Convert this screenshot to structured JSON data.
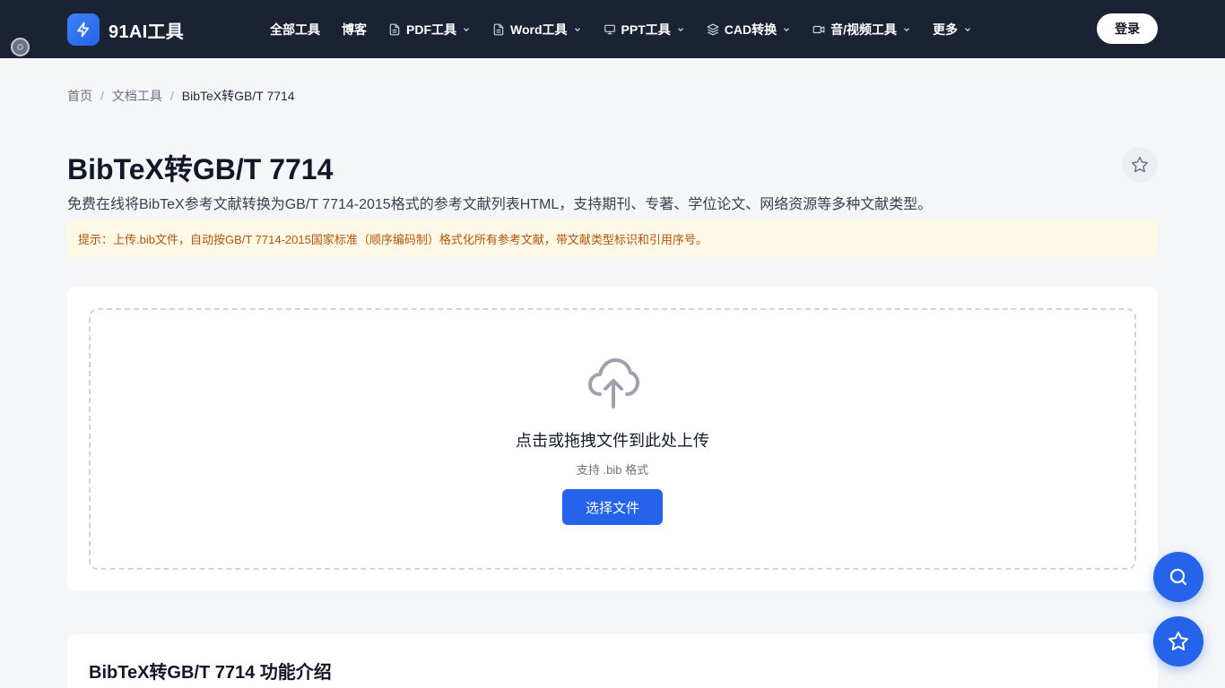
{
  "header": {
    "logo_text": "91AI工具",
    "nav": [
      {
        "label": "全部工具",
        "icon": null
      },
      {
        "label": "博客",
        "icon": null
      },
      {
        "label": "PDF工具",
        "icon": "document-icon"
      },
      {
        "label": "Word工具",
        "icon": "document-icon"
      },
      {
        "label": "PPT工具",
        "icon": "presentation-icon"
      },
      {
        "label": "CAD转换",
        "icon": "layers-icon"
      },
      {
        "label": "音/视频工具",
        "icon": "video-icon"
      },
      {
        "label": "更多",
        "icon": null
      }
    ],
    "login_label": "登录"
  },
  "breadcrumb": {
    "home": "首页",
    "category": "文档工具",
    "current": "BibTeX转GB/T 7714"
  },
  "page": {
    "title": "BibTeX转GB/T 7714",
    "description": "免费在线将BibTeX参考文献转换为GB/T 7714-2015格式的参考文献列表HTML，支持期刊、专著、学位论文、网络资源等多种文献类型。",
    "tip": "提示：上传.bib文件，自动按GB/T 7714-2015国家标准（顺序编码制）格式化所有参考文献，带文献类型标识和引用序号。"
  },
  "upload": {
    "title": "点击或拖拽文件到此处上传",
    "formats": "支持 .bib 格式",
    "button_label": "选择文件"
  },
  "intro": {
    "title": "BibTeX转GB/T 7714 功能介绍"
  },
  "colors": {
    "header_bg": "#1b2234",
    "accent": "#2563eb",
    "tip_bg": "#fef9e6",
    "tip_text": "#b45309"
  }
}
